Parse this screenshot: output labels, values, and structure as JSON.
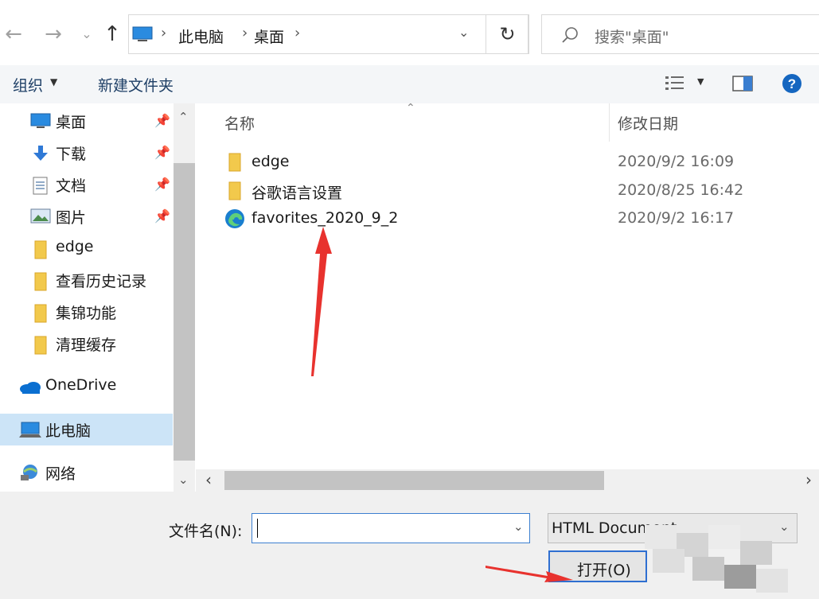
{
  "address": {
    "segments": [
      "此电脑",
      "桌面"
    ],
    "search_placeholder": "搜索\"桌面\""
  },
  "toolbar": {
    "organize": "组织",
    "new_folder": "新建文件夹"
  },
  "nav": {
    "quick": [
      {
        "label": "桌面",
        "icon": "desktop-icon",
        "pinned": true
      },
      {
        "label": "下载",
        "icon": "download-icon",
        "pinned": true
      },
      {
        "label": "文档",
        "icon": "document-icon",
        "pinned": true
      },
      {
        "label": "图片",
        "icon": "picture-icon",
        "pinned": true
      },
      {
        "label": "edge",
        "icon": "folder-icon",
        "pinned": false
      },
      {
        "label": "查看历史记录",
        "icon": "folder-icon",
        "pinned": false
      },
      {
        "label": "集锦功能",
        "icon": "folder-icon",
        "pinned": false
      },
      {
        "label": "清理缓存",
        "icon": "folder-icon",
        "pinned": false
      }
    ],
    "onedrive": "OneDrive",
    "this_pc": "此电脑",
    "network": "网络"
  },
  "columns": {
    "name": "名称",
    "modified": "修改日期"
  },
  "files": [
    {
      "name": "edge",
      "date": "2020/9/2 16:09",
      "icon": "folder-icon"
    },
    {
      "name": "谷歌语言设置",
      "date": "2020/8/25 16:42",
      "icon": "folder-icon"
    },
    {
      "name": "favorites_2020_9_2",
      "date": "2020/9/2 16:17",
      "icon": "edge-html-icon"
    }
  ],
  "bottom": {
    "filename_label": "文件名(N):",
    "filename_value": "",
    "filetype_value": "HTML Document",
    "open_button": "打开(O)"
  },
  "colors": {
    "accent": "#0078d7",
    "arrow": "#e8322e",
    "folder": "#e8b83a"
  }
}
